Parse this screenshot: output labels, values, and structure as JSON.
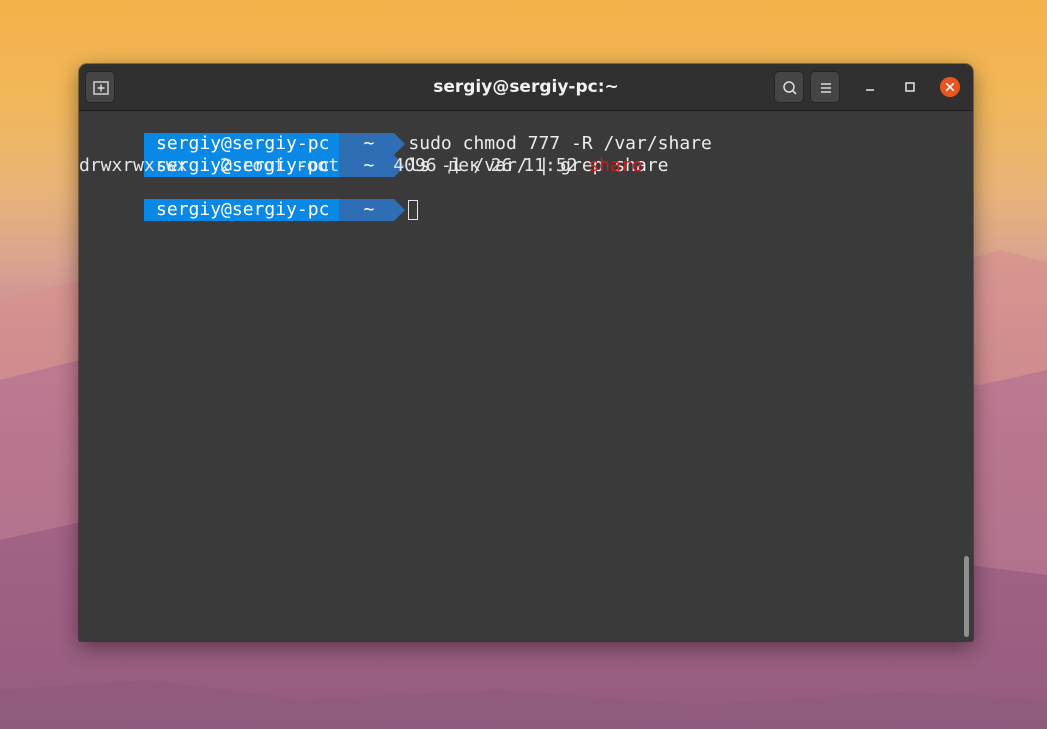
{
  "window": {
    "title": "sergiy@sergiy-pc:~"
  },
  "colors": {
    "prompt_user_bg": "#0a88e6",
    "prompt_dir_bg": "#2f6db4",
    "terminal_bg": "#3a3a3a",
    "titlebar_bg": "#303030",
    "close_button": "#e95420",
    "highlight_red": "#d21a1a"
  },
  "icons": {
    "new_tab": "new-tab-icon",
    "search": "search-icon",
    "menu": "hamburger-menu-icon",
    "minimize": "minimize-icon",
    "maximize": "maximize-icon",
    "close": "close-icon"
  },
  "terminal": {
    "prompt1": {
      "user": "sergiy@sergiy-pc",
      "dir": "~",
      "command": "sudo chmod 777 -R /var/share"
    },
    "prompt2": {
      "user": "sergiy@sergiy-pc",
      "dir": "~",
      "command": "ls -l /var/ | grep share"
    },
    "output1": {
      "text": "drwxrwxrwx   2 root root     4096 дек 26 11:52 ",
      "highlight": "share"
    },
    "prompt3": {
      "user": "sergiy@sergiy-pc",
      "dir": "~",
      "command": ""
    }
  }
}
